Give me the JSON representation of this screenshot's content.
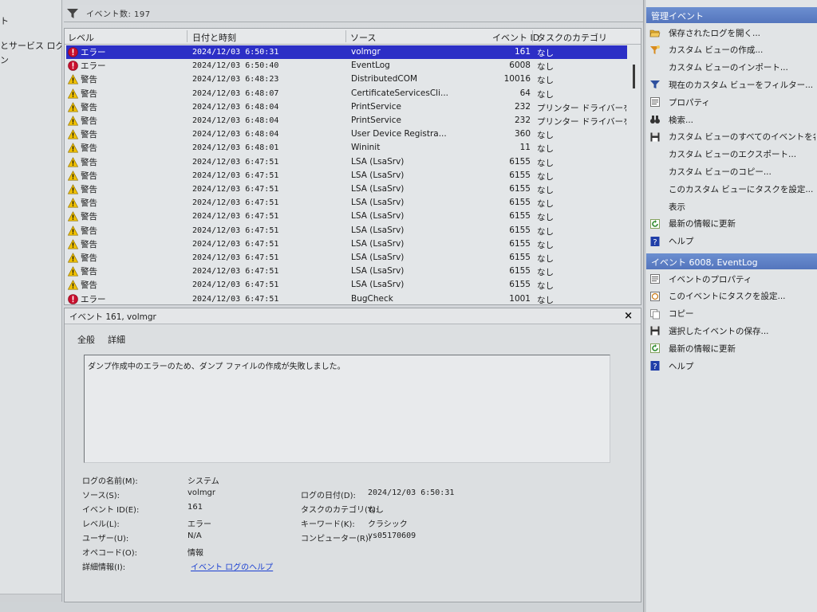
{
  "left_tree": {
    "items": [
      "ト",
      "とサービス ログ",
      "ン"
    ]
  },
  "filter_bar": {
    "count_text": "イベント数: 197"
  },
  "event_list": {
    "columns": {
      "level": "レベル",
      "date": "日付と時刻",
      "source": "ソース",
      "event_id": "イベント ID",
      "category": "タスクのカテゴリ"
    },
    "rows": [
      {
        "level": "エラー",
        "type": "error",
        "date": "2024/12/03 6:50:31",
        "source": "volmgr",
        "id": "161",
        "category": "なし",
        "selected": true
      },
      {
        "level": "エラー",
        "type": "error",
        "date": "2024/12/03 6:50:40",
        "source": "EventLog",
        "id": "6008",
        "category": "なし"
      },
      {
        "level": "警告",
        "type": "warning",
        "date": "2024/12/03 6:48:23",
        "source": "DistributedCOM",
        "id": "10016",
        "category": "なし"
      },
      {
        "level": "警告",
        "type": "warning",
        "date": "2024/12/03 6:48:07",
        "source": "CertificateServicesCli...",
        "id": "64",
        "category": "なし"
      },
      {
        "level": "警告",
        "type": "warning",
        "date": "2024/12/03 6:48:04",
        "source": "PrintService",
        "id": "232",
        "category": "プリンター ドライバーをイ..."
      },
      {
        "level": "警告",
        "type": "warning",
        "date": "2024/12/03 6:48:04",
        "source": "PrintService",
        "id": "232",
        "category": "プリンター ドライバーをイ..."
      },
      {
        "level": "警告",
        "type": "warning",
        "date": "2024/12/03 6:48:04",
        "source": "User Device Registra...",
        "id": "360",
        "category": "なし"
      },
      {
        "level": "警告",
        "type": "warning",
        "date": "2024/12/03 6:48:01",
        "source": "Wininit",
        "id": "11",
        "category": "なし"
      },
      {
        "level": "警告",
        "type": "warning",
        "date": "2024/12/03 6:47:51",
        "source": "LSA (LsaSrv)",
        "id": "6155",
        "category": "なし"
      },
      {
        "level": "警告",
        "type": "warning",
        "date": "2024/12/03 6:47:51",
        "source": "LSA (LsaSrv)",
        "id": "6155",
        "category": "なし"
      },
      {
        "level": "警告",
        "type": "warning",
        "date": "2024/12/03 6:47:51",
        "source": "LSA (LsaSrv)",
        "id": "6155",
        "category": "なし"
      },
      {
        "level": "警告",
        "type": "warning",
        "date": "2024/12/03 6:47:51",
        "source": "LSA (LsaSrv)",
        "id": "6155",
        "category": "なし"
      },
      {
        "level": "警告",
        "type": "warning",
        "date": "2024/12/03 6:47:51",
        "source": "LSA (LsaSrv)",
        "id": "6155",
        "category": "なし"
      },
      {
        "level": "警告",
        "type": "warning",
        "date": "2024/12/03 6:47:51",
        "source": "LSA (LsaSrv)",
        "id": "6155",
        "category": "なし"
      },
      {
        "level": "警告",
        "type": "warning",
        "date": "2024/12/03 6:47:51",
        "source": "LSA (LsaSrv)",
        "id": "6155",
        "category": "なし"
      },
      {
        "level": "警告",
        "type": "warning",
        "date": "2024/12/03 6:47:51",
        "source": "LSA (LsaSrv)",
        "id": "6155",
        "category": "なし"
      },
      {
        "level": "警告",
        "type": "warning",
        "date": "2024/12/03 6:47:51",
        "source": "LSA (LsaSrv)",
        "id": "6155",
        "category": "なし"
      },
      {
        "level": "警告",
        "type": "warning",
        "date": "2024/12/03 6:47:51",
        "source": "LSA (LsaSrv)",
        "id": "6155",
        "category": "なし"
      },
      {
        "level": "エラー",
        "type": "error",
        "date": "2024/12/03 6:47:51",
        "source": "BugCheck",
        "id": "1001",
        "category": "なし"
      }
    ]
  },
  "detail": {
    "title": "イベント 161, volmgr",
    "close_label": "×",
    "tabs": [
      "全般",
      "詳細"
    ],
    "description": "ダンプ作成中のエラーのため、ダンプ ファイルの作成が失敗しました。",
    "props": {
      "log_name_label": "ログの名前(M):",
      "log_name_value": "システム",
      "source_label": "ソース(S):",
      "source_value": "volmgr",
      "logged_label": "ログの日付(D):",
      "logged_value": "2024/12/03 6:50:31",
      "event_id_label": "イベント ID(E):",
      "event_id_value": "161",
      "task_label": "タスクのカテゴリ(Y):",
      "task_value": "なし",
      "level_label": "レベル(L):",
      "level_value": "エラー",
      "keywords_label": "キーワード(K):",
      "keywords_value": "クラシック",
      "user_label": "ユーザー(U):",
      "user_value": "N/A",
      "computer_label": "コンピューター(R):",
      "computer_value": "ys05170609",
      "opcode_label": "オペコード(O):",
      "opcode_value": "情報",
      "more_info_label": "詳細情報(I):",
      "more_info_link": "イベント ログのヘルプ"
    }
  },
  "actions": {
    "section1_title": "管理イベント",
    "section1_items": [
      {
        "label": "保存されたログを開く...",
        "icon": "folder-open-icon"
      },
      {
        "label": "カスタム ビューの作成...",
        "icon": "filter-create-icon"
      },
      {
        "label": "カスタム ビューのインポート...",
        "icon": "blank"
      },
      {
        "label": "現在のカスタム ビューをフィルター...",
        "icon": "filter-icon"
      },
      {
        "label": "プロパティ",
        "icon": "properties-icon"
      },
      {
        "label": "検索...",
        "icon": "binoculars-icon"
      },
      {
        "label": "カスタム ビューのすべてのイベントを名前を付け",
        "icon": "save-icon"
      },
      {
        "label": "カスタム ビューのエクスポート...",
        "icon": "blank"
      },
      {
        "label": "カスタム ビューのコピー...",
        "icon": "blank"
      },
      {
        "label": "このカスタム ビューにタスクを設定...",
        "icon": "blank"
      },
      {
        "label": "表示",
        "icon": "blank"
      },
      {
        "label": "最新の情報に更新",
        "icon": "refresh-icon"
      },
      {
        "label": "ヘルプ",
        "icon": "help-icon"
      }
    ],
    "section2_title": "イベント 6008, EventLog",
    "section2_items": [
      {
        "label": "イベントのプロパティ",
        "icon": "properties-icon"
      },
      {
        "label": "このイベントにタスクを設定...",
        "icon": "task-icon"
      },
      {
        "label": "コピー",
        "icon": "copy-icon"
      },
      {
        "label": "選択したイベントの保存...",
        "icon": "save-icon"
      },
      {
        "label": "最新の情報に更新",
        "icon": "refresh-icon"
      },
      {
        "label": "ヘルプ",
        "icon": "help-icon"
      }
    ]
  },
  "colors": {
    "selection": "#2c2fc6",
    "header_blue": "#5e80c6",
    "error_red": "#c8102e",
    "warning_yellow": "#f2c200",
    "link_blue": "#1a3fd1"
  }
}
